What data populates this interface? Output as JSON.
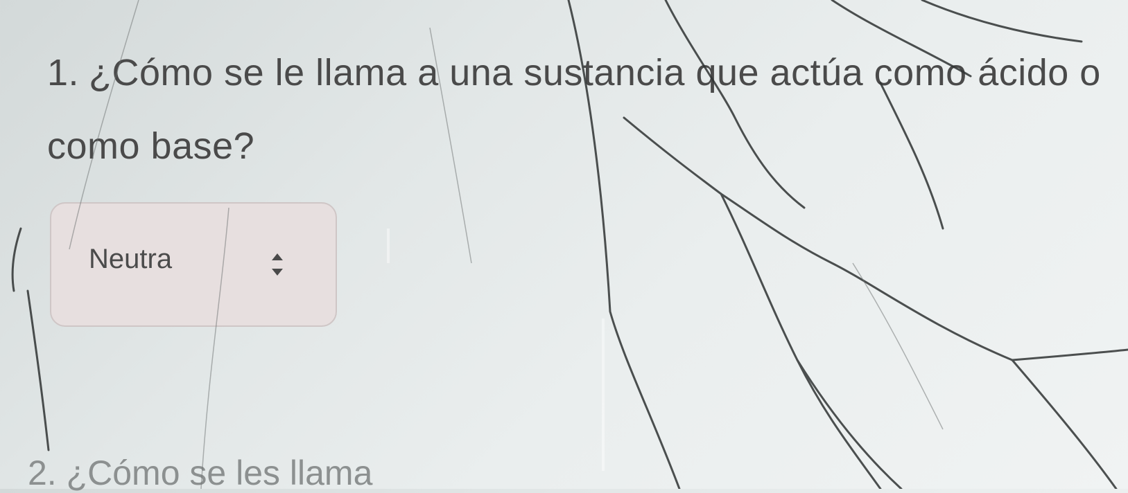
{
  "question_1": {
    "number": "1.",
    "text": "¿Cómo se le llama a una sustancia que actúa como ácido o como base?"
  },
  "answer_select": {
    "selected_value": "Neutra"
  },
  "question_2": {
    "partial_text": "2. ¿Cómo se les llama"
  },
  "icons": {
    "select_arrows": "up-down-chevron-icon"
  }
}
